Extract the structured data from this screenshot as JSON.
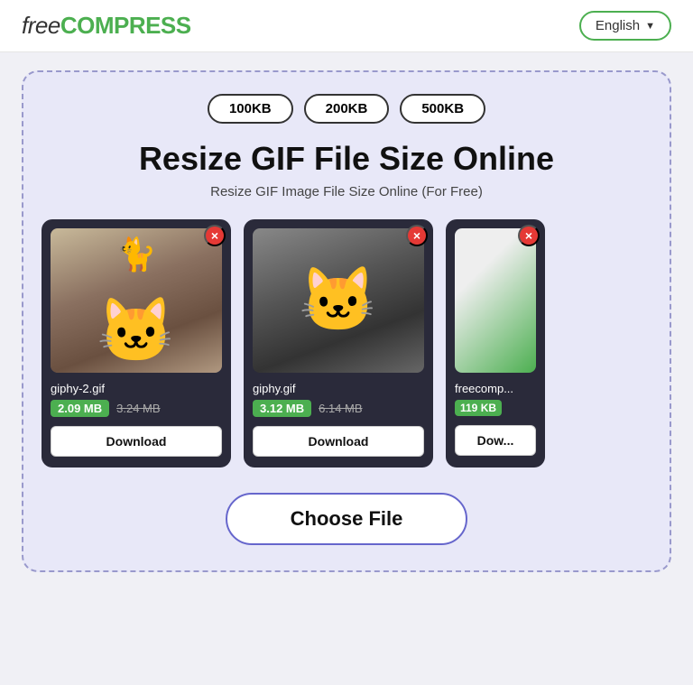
{
  "header": {
    "logo_free": "free",
    "logo_compress": "COMPRESS",
    "lang_label": "English",
    "lang_chevron": "▼"
  },
  "size_buttons": [
    "100KB",
    "200KB",
    "500KB"
  ],
  "main_title": "Resize GIF File Size Online",
  "sub_title": "Resize GIF Image File Size Online (For Free)",
  "cards": [
    {
      "filename": "giphy-2.gif",
      "size_new": "2.09 MB",
      "size_old": "3.24 MB",
      "download_label": "Download",
      "close_label": "×",
      "image_type": "cat1"
    },
    {
      "filename": "giphy.gif",
      "size_new": "3.12 MB",
      "size_old": "6.14 MB",
      "download_label": "Download",
      "close_label": "×",
      "image_type": "cat2"
    },
    {
      "filename": "freecomp...",
      "size_new": "119 KB",
      "size_old": "",
      "download_label": "Dow...",
      "close_label": "×",
      "image_type": "partial"
    }
  ],
  "choose_file_label": "Choose File"
}
